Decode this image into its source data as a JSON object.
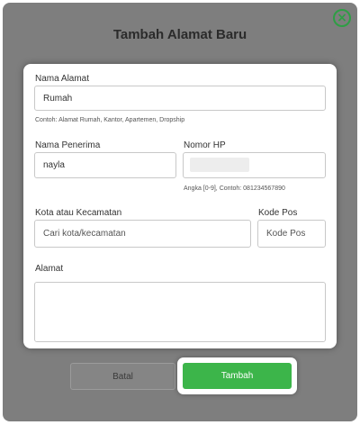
{
  "modal": {
    "title": "Tambah Alamat Baru",
    "close_icon": "close-circle-icon",
    "accent_color": "#3cb54a"
  },
  "form": {
    "address_name": {
      "label": "Nama Alamat",
      "value": "Rumah",
      "hint": "Contoh: Alamat Rumah, Kantor, Apartemen, Dropship"
    },
    "recipient": {
      "label": "Nama Penerima",
      "value": "nayla"
    },
    "phone": {
      "label": "Nomor HP",
      "value": "",
      "hint": "Angka [0-9], Contoh: 081234567890"
    },
    "city": {
      "label": "Kota atau Kecamatan",
      "placeholder": "Cari kota/kecamatan"
    },
    "postal": {
      "label": "Kode Pos",
      "placeholder": "Kode Pos"
    },
    "address": {
      "label": "Alamat",
      "value": ""
    }
  },
  "actions": {
    "cancel_label": "Batal",
    "submit_label": "Tambah"
  }
}
